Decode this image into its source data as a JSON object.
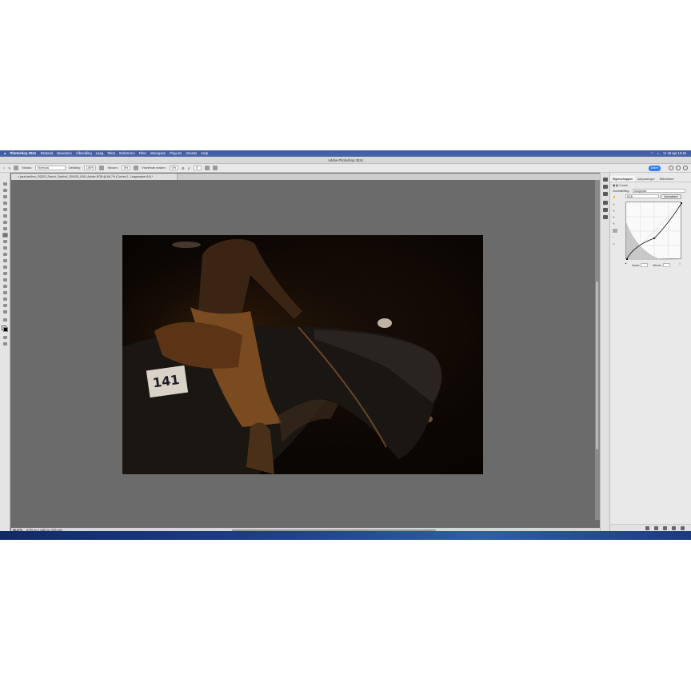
{
  "menubar": {
    "apple": "",
    "app_name": "Photoshop 2024",
    "items": [
      "Bestand",
      "Bewerken",
      "Afbeelding",
      "Laag",
      "Tekst",
      "Selecteren",
      "Filter",
      "Weergave",
      "Plug-ins",
      "Venster",
      "Help"
    ],
    "clock": "Vr 29 apr  19:40"
  },
  "window": {
    "title": "Adobe Photoshop 2024"
  },
  "options": {
    "mode_label": "Modus:",
    "mode_value": "Normaal",
    "opacity_label": "Dekking:",
    "opacity_value": "100%",
    "flow_label": "Stroom:",
    "flow_value": "8%",
    "smoothing_label": "Vloeiende maken:",
    "smoothing_value": "0%",
    "angle_value": "0°",
    "share_label": "Delen"
  },
  "document": {
    "tab_label": "× jazzt.sedimo_RQDS_Ranch_Santhof_200420_0061.Adobe RGB @ 66,7% (Curves 1, Laagmasker/16) *"
  },
  "status": {
    "zoom": "66,67%",
    "info": "6720 px x 4480 px (300 ppi)"
  },
  "properties": {
    "tabs": [
      "Eigenschappen",
      "Aanpassingen",
      "Bibliotheken"
    ],
    "panel_title": "Curven",
    "preset_label": "Voorinstelling:",
    "preset_value": "Aangepast",
    "channel_value": "RGB",
    "auto_label": "Automatisch",
    "input_label": "Invoer:",
    "output_label": "Uitvoer:"
  },
  "curve": {
    "points": [
      [
        0,
        0
      ],
      [
        128,
        96
      ],
      [
        255,
        255
      ]
    ]
  },
  "colors": {
    "accent": "#2d7ff9",
    "menubar": "#3e5a9f",
    "canvas_bg": "#6b6b6b"
  }
}
